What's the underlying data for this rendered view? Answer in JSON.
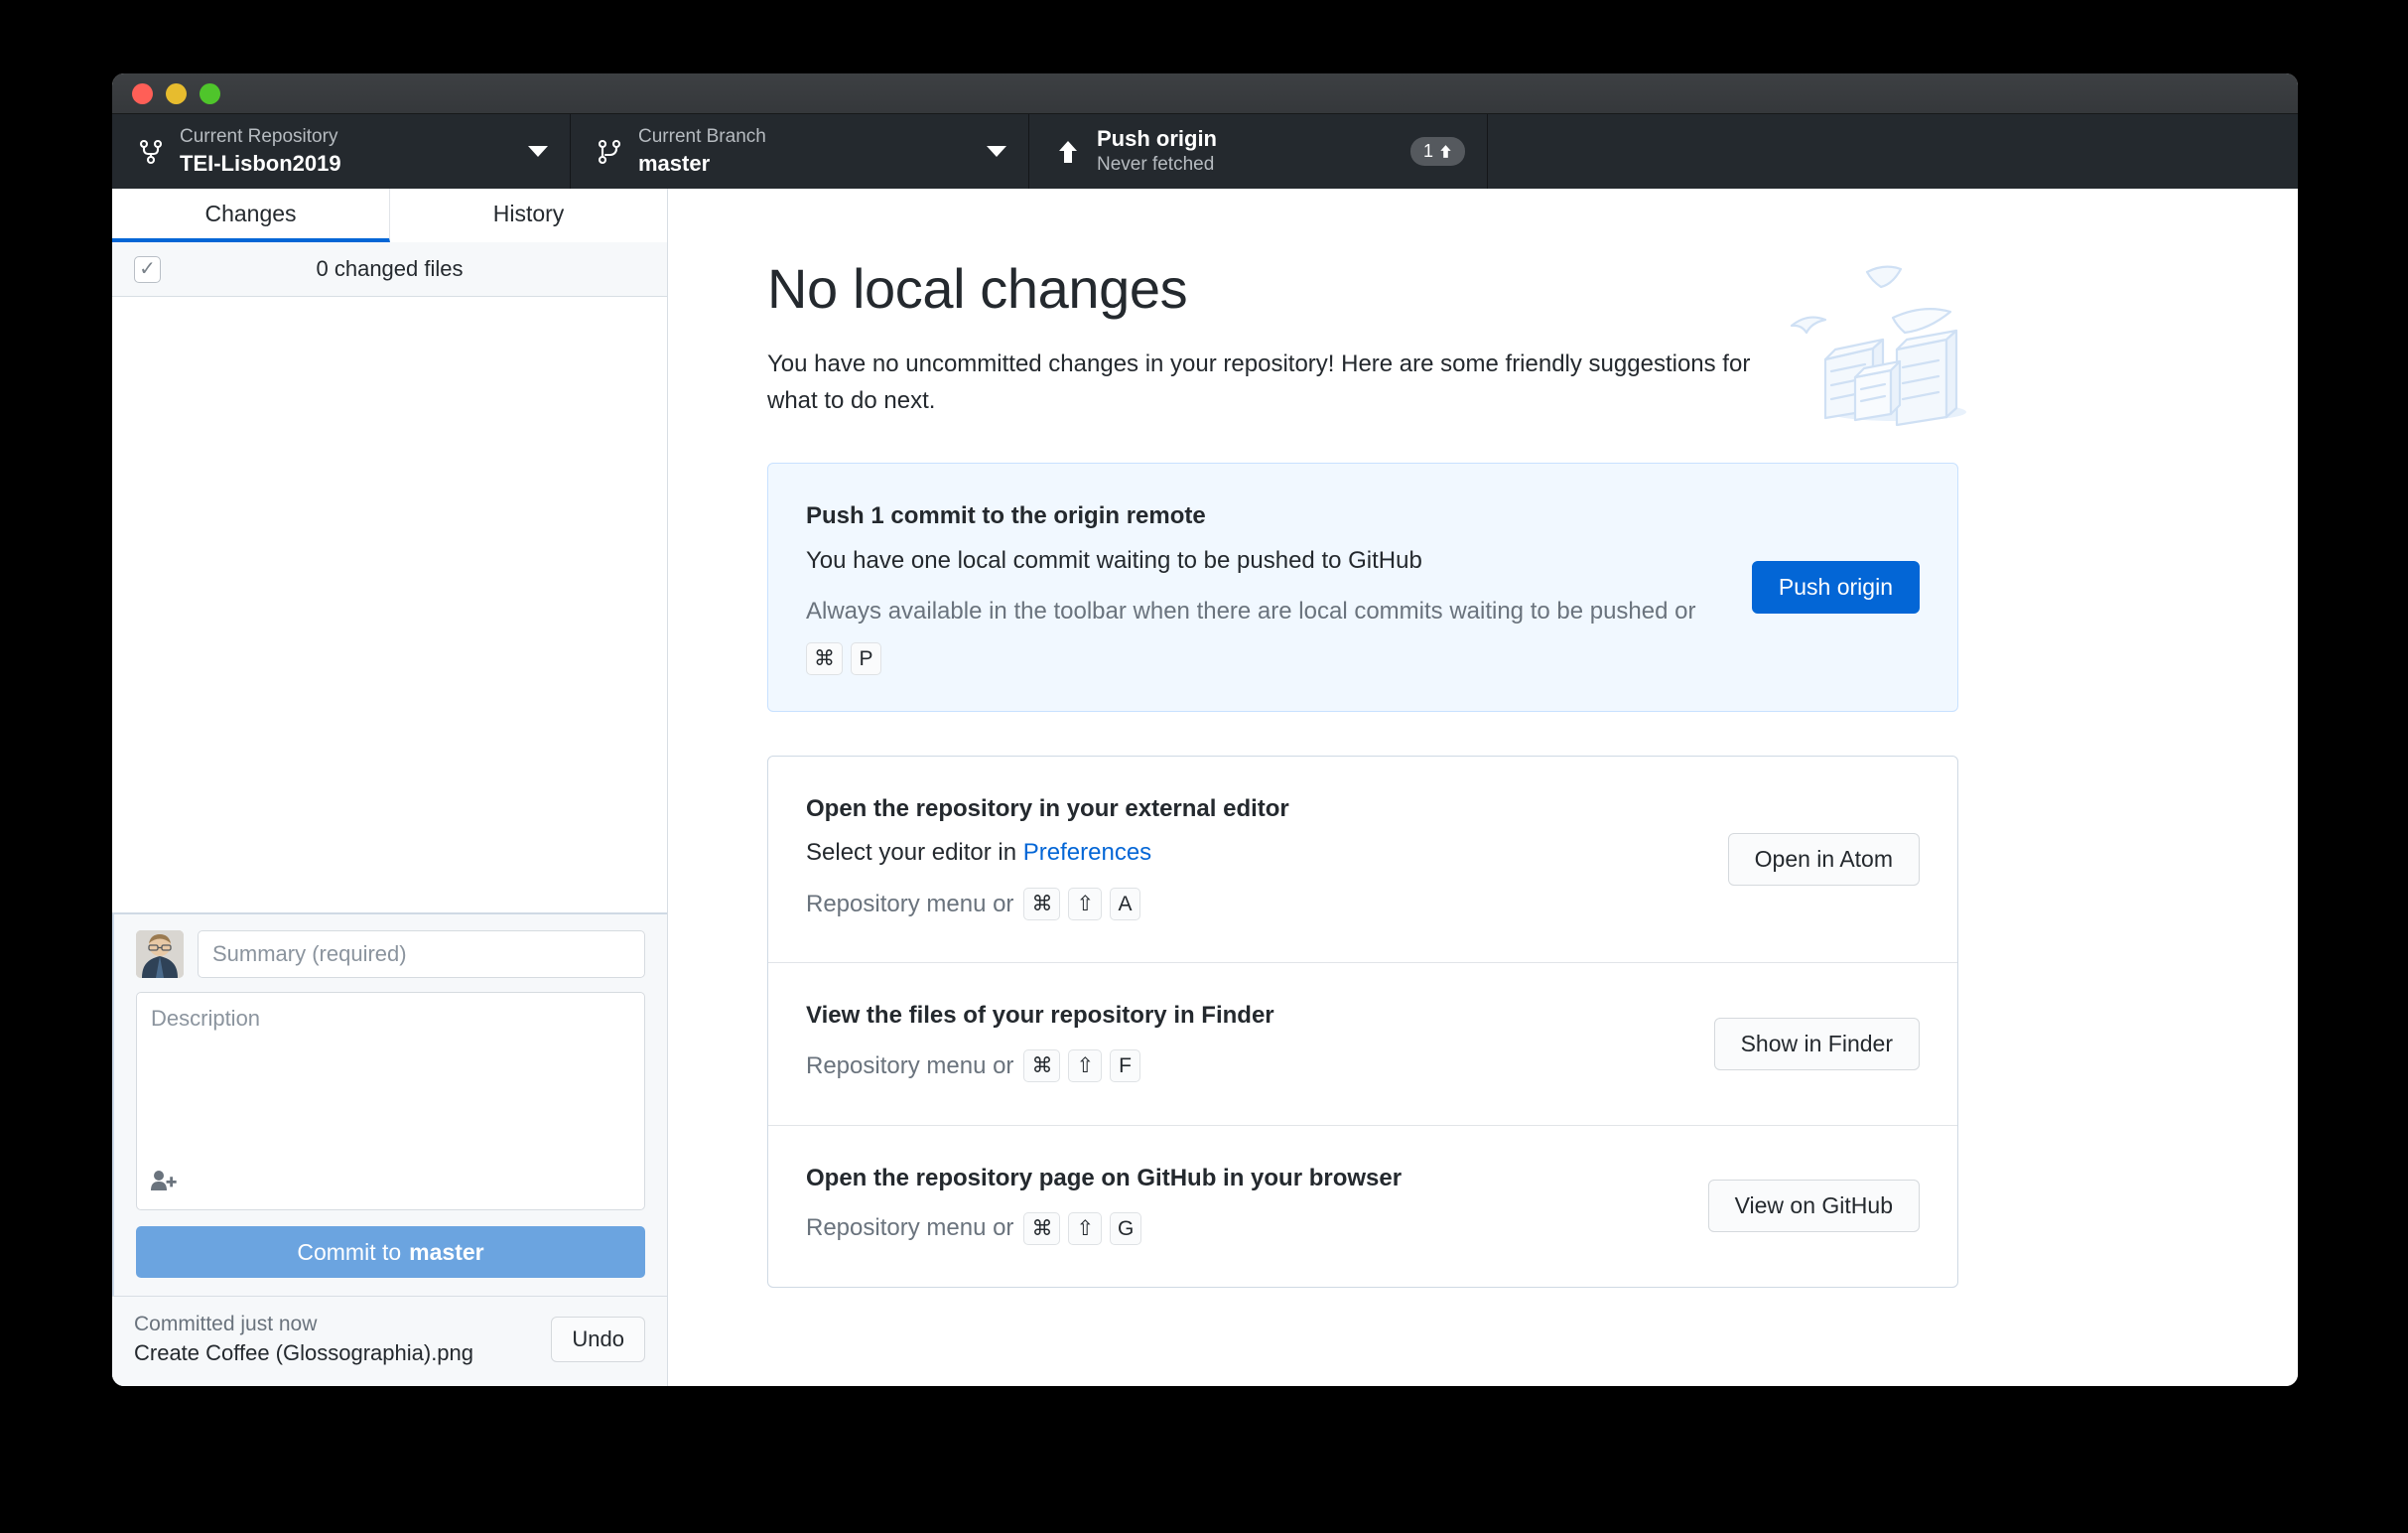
{
  "toolbar": {
    "repository": {
      "label": "Current Repository",
      "value": "TEI-Lisbon2019",
      "icon": "repo-branch-icon"
    },
    "branch": {
      "label": "Current Branch",
      "value": "master",
      "icon": "branch-icon"
    },
    "push": {
      "label": "Push origin",
      "value": "Never fetched",
      "icon": "arrow-up-icon",
      "ahead_count": "1"
    }
  },
  "sidebar": {
    "tabs": [
      {
        "label": "Changes",
        "active": true
      },
      {
        "label": "History",
        "active": false
      }
    ],
    "changed_files_label": "0 changed files",
    "checkbox_glyph": "✓",
    "commit": {
      "summary_placeholder": "Summary (required)",
      "description_placeholder": "Description",
      "button_prefix": "Commit to ",
      "button_branch": "master"
    },
    "undo": {
      "status": "Committed just now",
      "commit_message": "Create Coffee (Glossographia).png",
      "button_label": "Undo"
    }
  },
  "main": {
    "title": "No local changes",
    "subtitle": "You have no uncommitted changes in your repository! Here are some friendly suggestions for what to do next.",
    "push_card": {
      "title": "Push 1 commit to the origin remote",
      "description": "You have one local commit waiting to be pushed to GitHub",
      "hint_prefix": "Always available in the toolbar when there are local commits waiting to be pushed or ",
      "keys": [
        "⌘",
        "P"
      ],
      "button_label": "Push origin"
    },
    "suggestions": [
      {
        "title": "Open the repository in your external editor",
        "desc_prefix": "Select your editor in ",
        "desc_link": "Preferences",
        "hint_prefix": "Repository menu or ",
        "keys": [
          "⌘",
          "⇧",
          "A"
        ],
        "button_label": "Open in Atom"
      },
      {
        "title": "View the files of your repository in Finder",
        "desc_prefix": "",
        "desc_link": "",
        "hint_prefix": "Repository menu or ",
        "keys": [
          "⌘",
          "⇧",
          "F"
        ],
        "button_label": "Show in Finder"
      },
      {
        "title": "Open the repository page on GitHub in your browser",
        "desc_prefix": "",
        "desc_link": "",
        "hint_prefix": "Repository menu or ",
        "keys": [
          "⌘",
          "⇧",
          "G"
        ],
        "button_label": "View on GitHub"
      }
    ]
  },
  "colors": {
    "accent_blue": "#0366d6",
    "toolbar_bg": "#24292e",
    "highlight_card_bg": "#f1f8ff",
    "commit_button": "#6ba4e0",
    "illustration": "#cfe0f4"
  }
}
